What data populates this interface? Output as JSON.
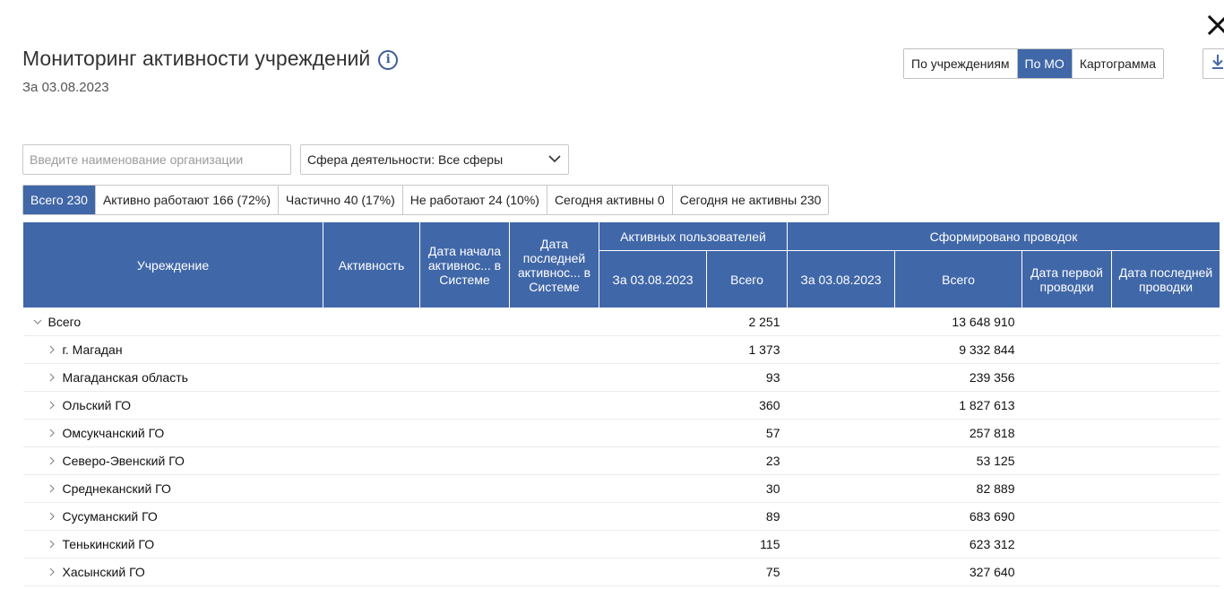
{
  "header": {
    "title": "Мониторинг активности учреждений",
    "subtitle": "За 03.08.2023"
  },
  "view_toggle": [
    {
      "label": "По учреждениям",
      "active": false
    },
    {
      "label": "По МО",
      "active": true
    },
    {
      "label": "Картограмма",
      "active": false
    }
  ],
  "filters": {
    "search_placeholder": "Введите наименование организации",
    "sphere_label": "Сфера деятельности: Все сферы"
  },
  "status_tabs": [
    {
      "label": "Всего 230",
      "active": true
    },
    {
      "label": "Активно работают 166 (72%)",
      "active": false
    },
    {
      "label": "Частично 40 (17%)",
      "active": false
    },
    {
      "label": "Не работают 24 (10%)",
      "active": false
    },
    {
      "label": "Сегодня активны 0",
      "active": false
    },
    {
      "label": "Сегодня не активны 230",
      "active": false
    }
  ],
  "table": {
    "headers": {
      "institution": "Учреждение",
      "activity": "Активность",
      "start_date": "Дата начала активнос... в Системе",
      "last_date": "Дата последней активнос... в Системе",
      "active_users_group": "Активных пользователей",
      "postings_group": "Сформировано проводок",
      "users_on_date": "За 03.08.2023",
      "users_total": "Всего",
      "postings_on_date": "За 03.08.2023",
      "postings_total": "Всего",
      "first_posting_date": "Дата первой проводки",
      "last_posting_date": "Дата последней проводки"
    },
    "rows": [
      {
        "name": "Всего",
        "level": 0,
        "expanded": true,
        "users_total": "2 251",
        "postings_total": "13 648 910"
      },
      {
        "name": "г. Магадан",
        "level": 1,
        "expanded": false,
        "users_total": "1 373",
        "postings_total": "9 332 844"
      },
      {
        "name": "Магаданская область",
        "level": 1,
        "expanded": false,
        "users_total": "93",
        "postings_total": "239 356"
      },
      {
        "name": "Ольский ГО",
        "level": 1,
        "expanded": false,
        "users_total": "360",
        "postings_total": "1 827 613"
      },
      {
        "name": "Омсукчанский ГО",
        "level": 1,
        "expanded": false,
        "users_total": "57",
        "postings_total": "257 818"
      },
      {
        "name": "Северо-Эвенский ГО",
        "level": 1,
        "expanded": false,
        "users_total": "23",
        "postings_total": "53 125"
      },
      {
        "name": "Среднеканский ГО",
        "level": 1,
        "expanded": false,
        "users_total": "30",
        "postings_total": "82 889"
      },
      {
        "name": "Сусуманский ГО",
        "level": 1,
        "expanded": false,
        "users_total": "89",
        "postings_total": "683 690"
      },
      {
        "name": "Тенькинский ГО",
        "level": 1,
        "expanded": false,
        "users_total": "115",
        "postings_total": "623 312"
      },
      {
        "name": "Хасынский ГО",
        "level": 1,
        "expanded": false,
        "users_total": "75",
        "postings_total": "327 640"
      }
    ]
  },
  "colors": {
    "accent": "#4067a8",
    "info_icon": "#3d5c97"
  },
  "icons": {
    "info": "info-icon",
    "close": "close-icon",
    "download": "download-icon",
    "dropdown": "chevron-down-icon",
    "collapse": "chevron-down-icon",
    "expand": "chevron-right-icon"
  }
}
